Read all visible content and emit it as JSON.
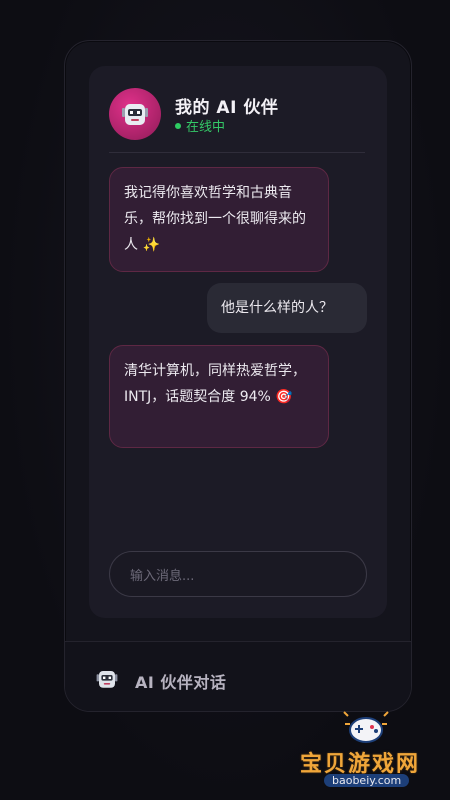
{
  "companion": {
    "name": "我的 AI 伙伴",
    "status": "在线中",
    "avatar_icon": "robot-icon"
  },
  "messages": [
    {
      "role": "ai",
      "text": "我记得你喜欢哲学和古典音乐，帮你找到一个很聊得来的人 ✨"
    },
    {
      "role": "user",
      "text": "他是什么样的人？"
    },
    {
      "role": "ai",
      "text": "清华计算机，同样热爱哲学，INTJ，话题契合度 94% 🎯"
    }
  ],
  "input": {
    "placeholder": "输入消息..."
  },
  "tab": {
    "label": "AI 伙伴对话",
    "icon": "robot-icon"
  },
  "watermark": {
    "brand": "宝贝游戏网",
    "url": "baobeiy.com"
  },
  "colors": {
    "accent": "#c2277a",
    "online": "#34c867",
    "ai_bubble": "#321e34",
    "user_bubble": "#2a2a35",
    "watermark": "#f0a63a"
  }
}
